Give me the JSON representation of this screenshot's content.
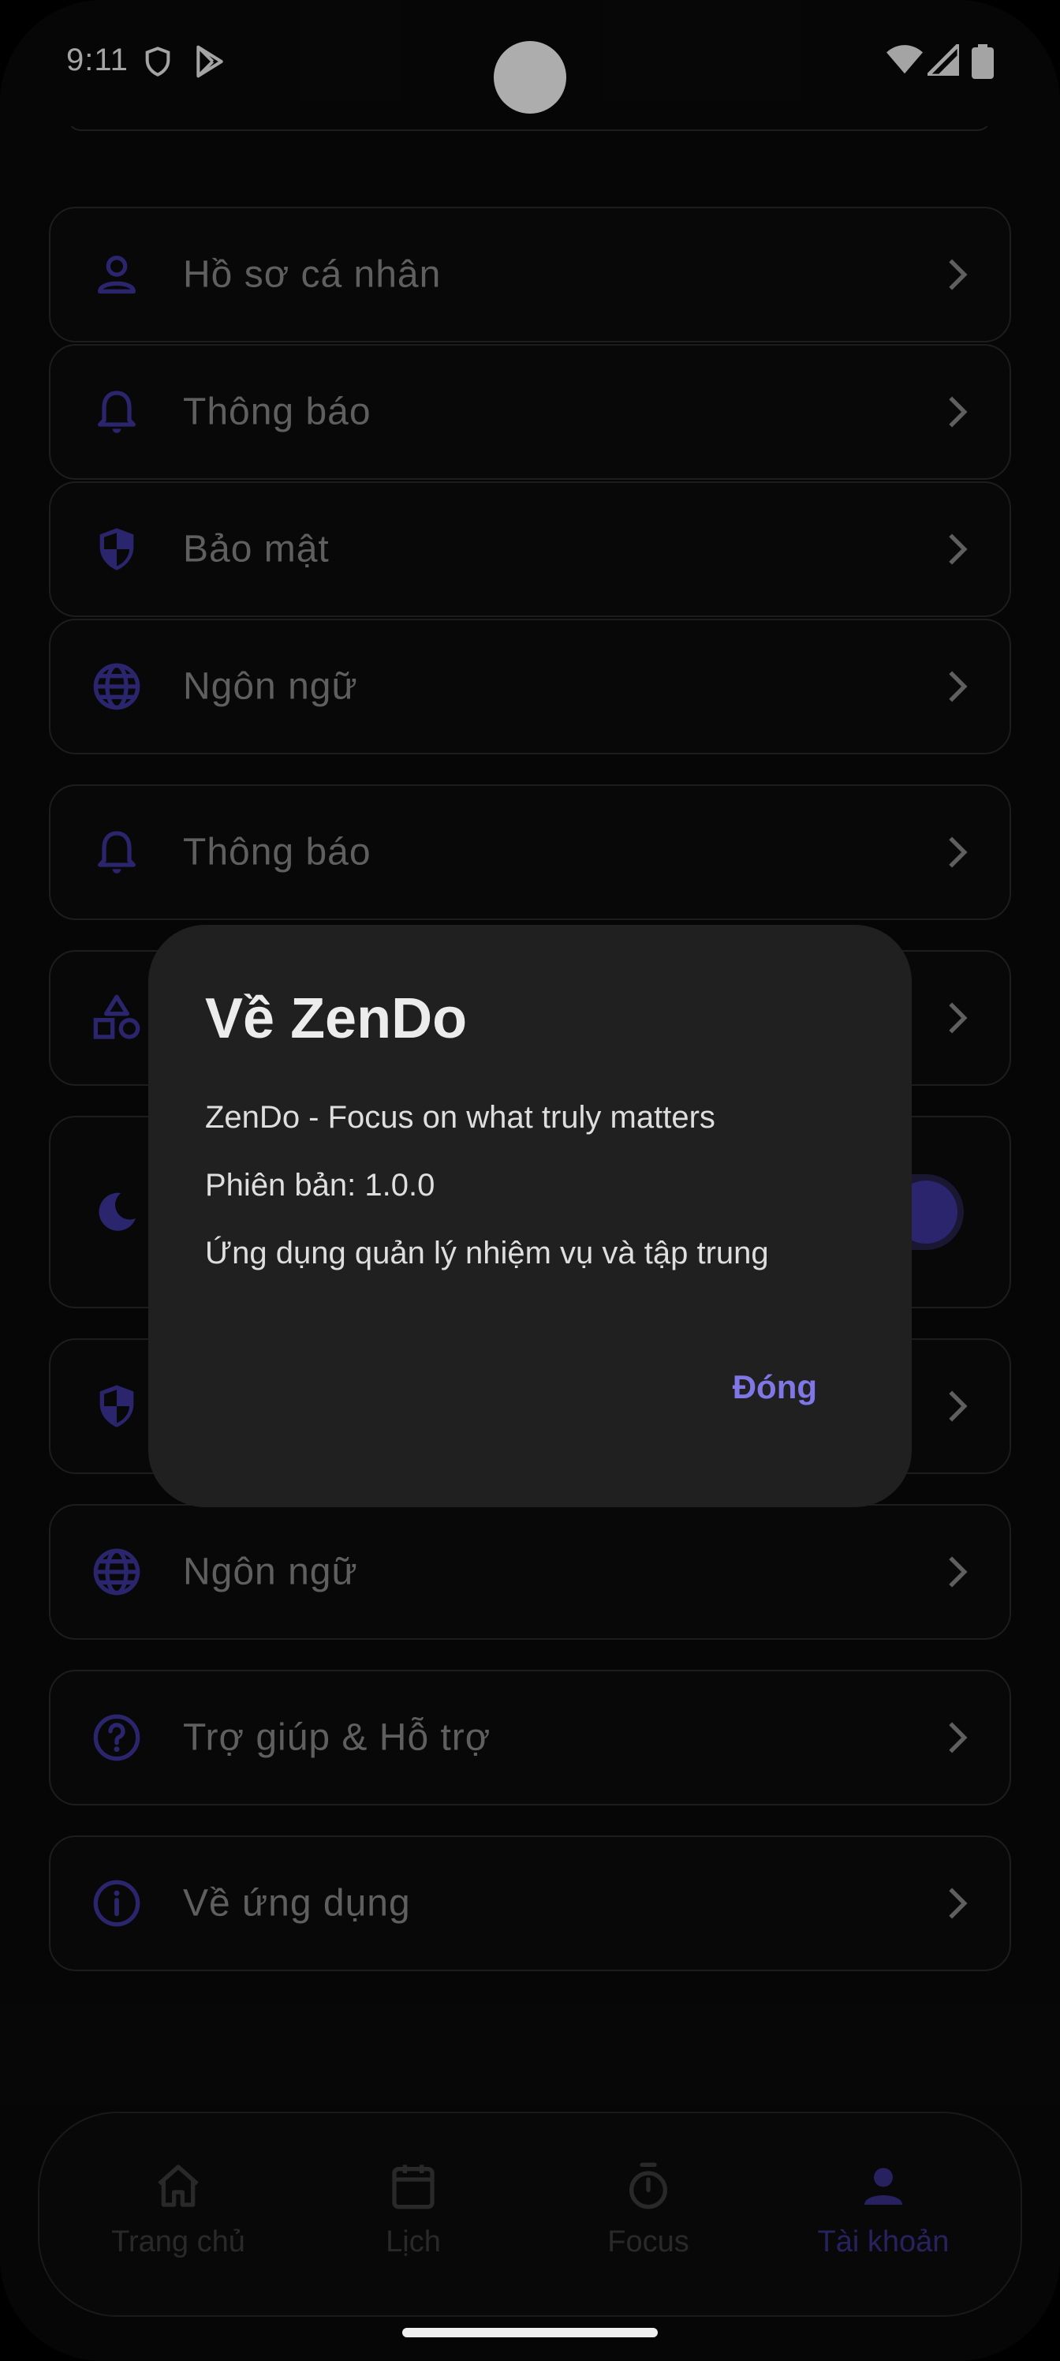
{
  "status_bar": {
    "time": "9:11",
    "left_icons": [
      "shield-icon",
      "play-store-icon"
    ],
    "right_icons": [
      "wifi-icon",
      "signal-icon",
      "battery-icon"
    ]
  },
  "settings_items": [
    {
      "label": "Hồ sơ cá nhân",
      "icon": "person-icon"
    },
    {
      "label": "Thông báo",
      "icon": "bell-icon"
    },
    {
      "label": "Bảo mật",
      "icon": "shield-icon"
    },
    {
      "label": "Ngôn ngữ",
      "icon": "globe-icon"
    },
    {
      "label": "Thông báo",
      "icon": "bell-icon"
    },
    {
      "label": "",
      "icon": "shapes-icon"
    },
    {
      "label": "",
      "icon": "moon-icon",
      "toggle_on": true
    },
    {
      "label": "",
      "icon": "shield-icon"
    },
    {
      "label": "Ngôn ngữ",
      "icon": "globe-icon"
    },
    {
      "label": "Trợ giúp & Hỗ trợ",
      "icon": "help-circle-icon"
    },
    {
      "label": "Về ứng dụng",
      "icon": "info-circle-icon"
    }
  ],
  "dialog": {
    "title": "Về ZenDo",
    "line1": "ZenDo - Focus on what truly matters",
    "line2": "Phiên bản: 1.0.0",
    "line3": "Ứng dụng quản lý nhiệm vụ và tập trung",
    "close_label": "Đóng"
  },
  "bottom_nav": {
    "items": [
      {
        "label": "Trang chủ",
        "icon": "home-icon",
        "active": false
      },
      {
        "label": "Lịch",
        "icon": "calendar-icon",
        "active": false
      },
      {
        "label": "Focus",
        "icon": "timer-icon",
        "active": false
      },
      {
        "label": "Tài khoản",
        "icon": "person-icon",
        "active": true
      }
    ]
  },
  "colors": {
    "accent": "#3f37a0",
    "accent_text": "#7f77e6",
    "background": "#0a0a0a",
    "dialog_bg": "#202020"
  }
}
